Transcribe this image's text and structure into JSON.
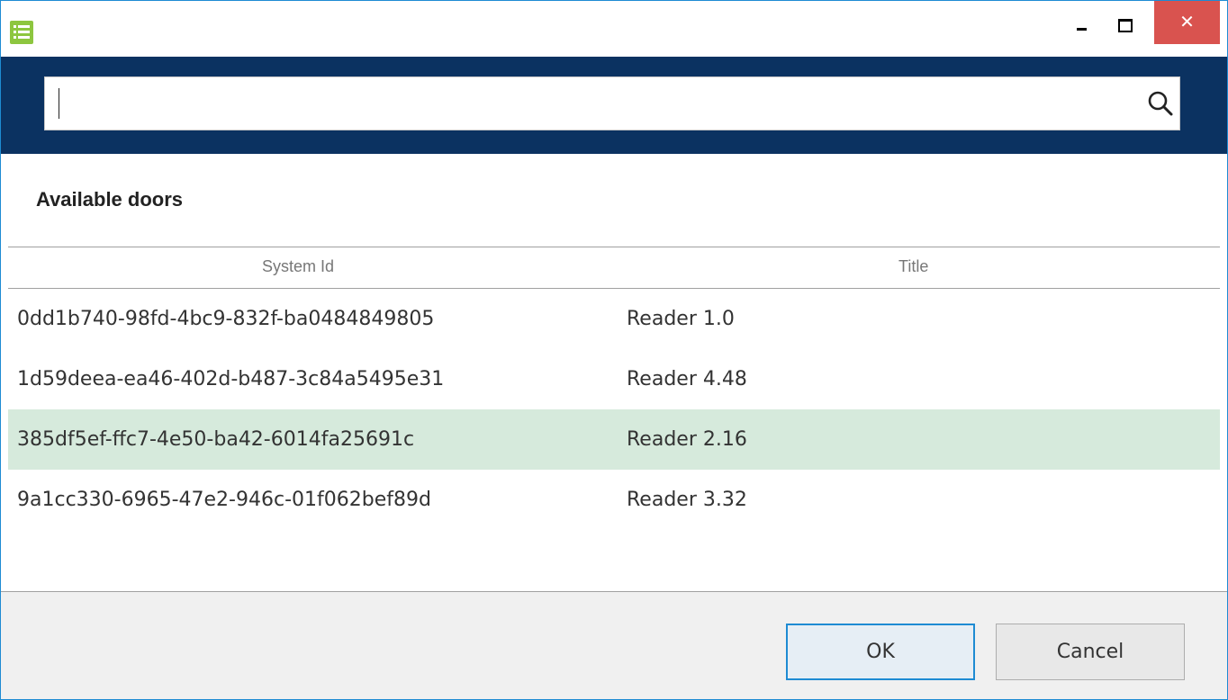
{
  "window": {
    "close_glyph": "✕",
    "app_icon": "list-icon",
    "minimize_icon": "minimize-icon",
    "maximize_icon": "maximize-icon"
  },
  "search": {
    "value": "",
    "placeholder": "",
    "icon": "search-icon"
  },
  "section": {
    "title": "Available doors"
  },
  "table": {
    "columns": [
      "System Id",
      "Title"
    ],
    "rows": [
      {
        "system_id": "0dd1b740-98fd-4bc9-832f-ba0484849805",
        "title": "Reader 1.0",
        "selected": false
      },
      {
        "system_id": "1d59deea-ea46-402d-b487-3c84a5495e31",
        "title": "Reader 4.48",
        "selected": false
      },
      {
        "system_id": "385df5ef-ffc7-4e50-ba42-6014fa25691c",
        "title": "Reader 2.16",
        "selected": true
      },
      {
        "system_id": "9a1cc330-6965-47e2-946c-01f062bef89d",
        "title": "Reader 3.32",
        "selected": false
      }
    ]
  },
  "buttons": {
    "ok": "OK",
    "cancel": "Cancel"
  },
  "colors": {
    "header_band": "#0b3261",
    "selected_row": "#d6eadc",
    "close_button": "#d9534f",
    "accent": "#1e8bd3"
  }
}
